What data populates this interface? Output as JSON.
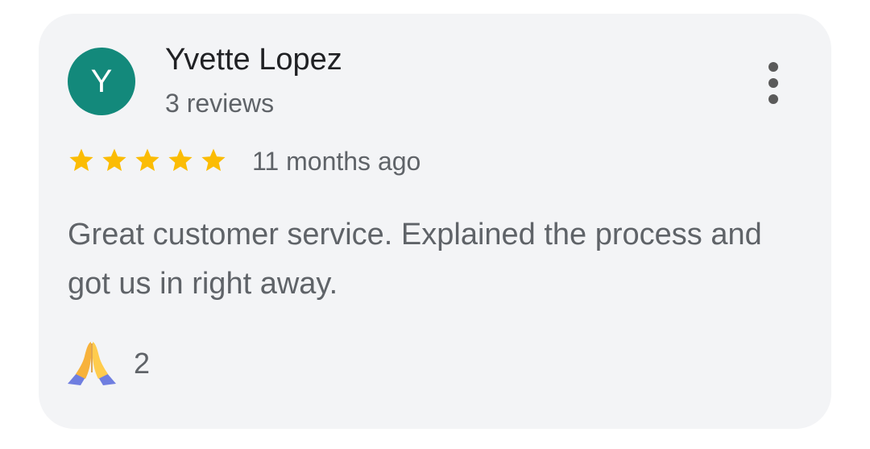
{
  "review": {
    "avatar_letter": "Y",
    "reviewer_name": "Yvette Lopez",
    "review_count": "3 reviews",
    "rating": 5,
    "rating_max": 5,
    "time_ago": "11 months ago",
    "text": "Great customer service. Explained the process and got us in right away.",
    "reaction": {
      "icon": "folded-hands-emoji",
      "count": "2"
    },
    "menu_icon": "more-vertical-icon"
  },
  "colors": {
    "avatar_bg": "#13897b",
    "star": "#fbbc04",
    "card_bg": "#f3f4f6"
  }
}
